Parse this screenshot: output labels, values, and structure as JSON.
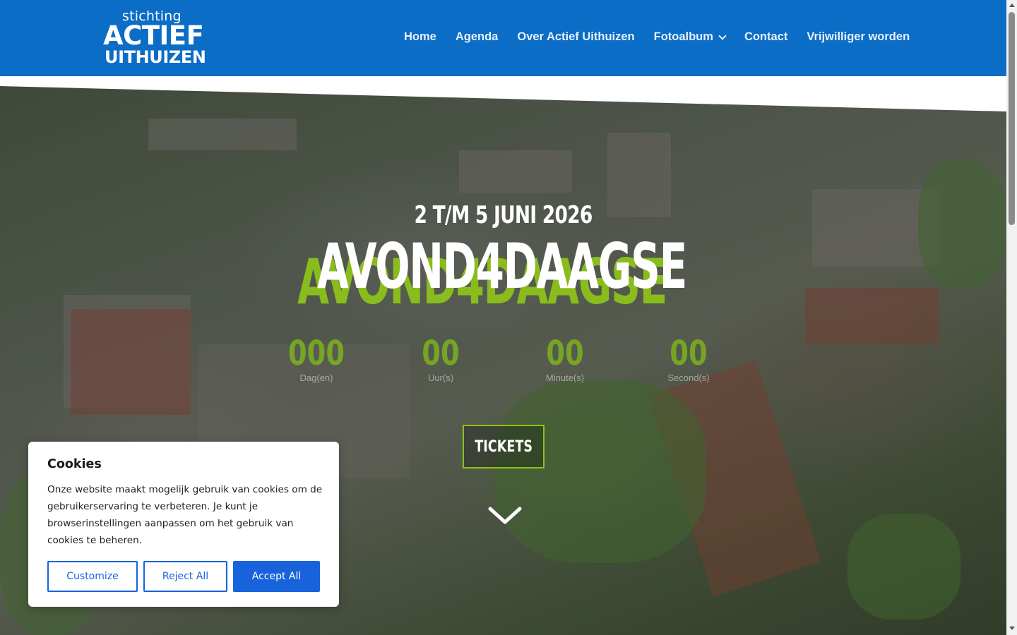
{
  "logo": {
    "line1": "stichting",
    "line2": "ACTIEF",
    "line3": "UITHUIZEN"
  },
  "nav": [
    {
      "label": "Home"
    },
    {
      "label": "Agenda"
    },
    {
      "label": "Over Actief Uithuizen"
    },
    {
      "label": "Fotoalbum",
      "has_dropdown": true
    },
    {
      "label": "Contact"
    },
    {
      "label": "Vrijwilliger worden"
    }
  ],
  "hero": {
    "date": "2 T/M 5 JUNI 2026",
    "title": "AVOND4DAAGSE",
    "countdown": [
      {
        "value": "000",
        "label": "Dag(en)"
      },
      {
        "value": "00",
        "label": "Uur(s)"
      },
      {
        "value": "00",
        "label": "Minute(s)"
      },
      {
        "value": "00",
        "label": "Second(s)"
      }
    ],
    "cta": "TICKETS"
  },
  "cookie": {
    "title": "Cookies",
    "text": "Onze website maakt mogelijk gebruik van cookies om de gebruikerservaring te verbeteren. Je kunt je browserinstellingen aanpassen om het gebruik van cookies te beheren.",
    "buttons": {
      "customize": "Customize",
      "reject": "Reject All",
      "accept": "Accept All"
    }
  },
  "colors": {
    "header": "#0b6dc6",
    "accent_green": "#8cc21a",
    "cookie_blue": "#1863dc"
  }
}
